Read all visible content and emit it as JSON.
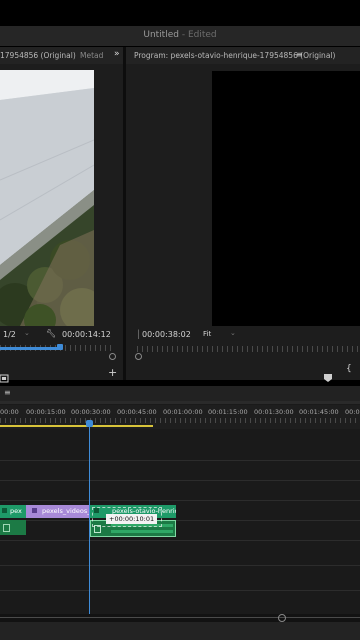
{
  "window": {
    "title": "Untitled",
    "edited_suffix": "- Edited"
  },
  "source_panel": {
    "tab_label": "17954856 (Original)",
    "next_tab_label": "Metad",
    "overflow_icon": "double-chevron-right-icon",
    "zoom_select": "1/2",
    "settings_icon": "wrench-icon",
    "timecode": "00:00:14:12"
  },
  "program_panel": {
    "tab_label": "Program: pexels-otavio-henrique-17954856 (Original)",
    "menu_icon": "hamburger-icon",
    "timecode": "00:00:38:02",
    "fit_select": "Fit"
  },
  "timeline": {
    "menu_icon": "hamburger-icon",
    "ruler_labels": [
      "00:00",
      "00:00:15:00",
      "00:00:30:00",
      "00:00:45:00",
      "00:01:00:00",
      "00:01:15:00",
      "00:01:30:00",
      "00:01:45:00",
      "00:02"
    ],
    "clips": {
      "v1_left": "pex",
      "v1_middle": "pexels_videos_2",
      "v1_right": "pexels-otavio-henrique-",
      "drag_tooltip": "+00:00:10:01"
    }
  },
  "colors": {
    "accent": "#3f8cd8",
    "clip_green": "#1e9a68",
    "clip_violet": "#a88ad8",
    "clip_dark_green": "#1c7a45"
  }
}
